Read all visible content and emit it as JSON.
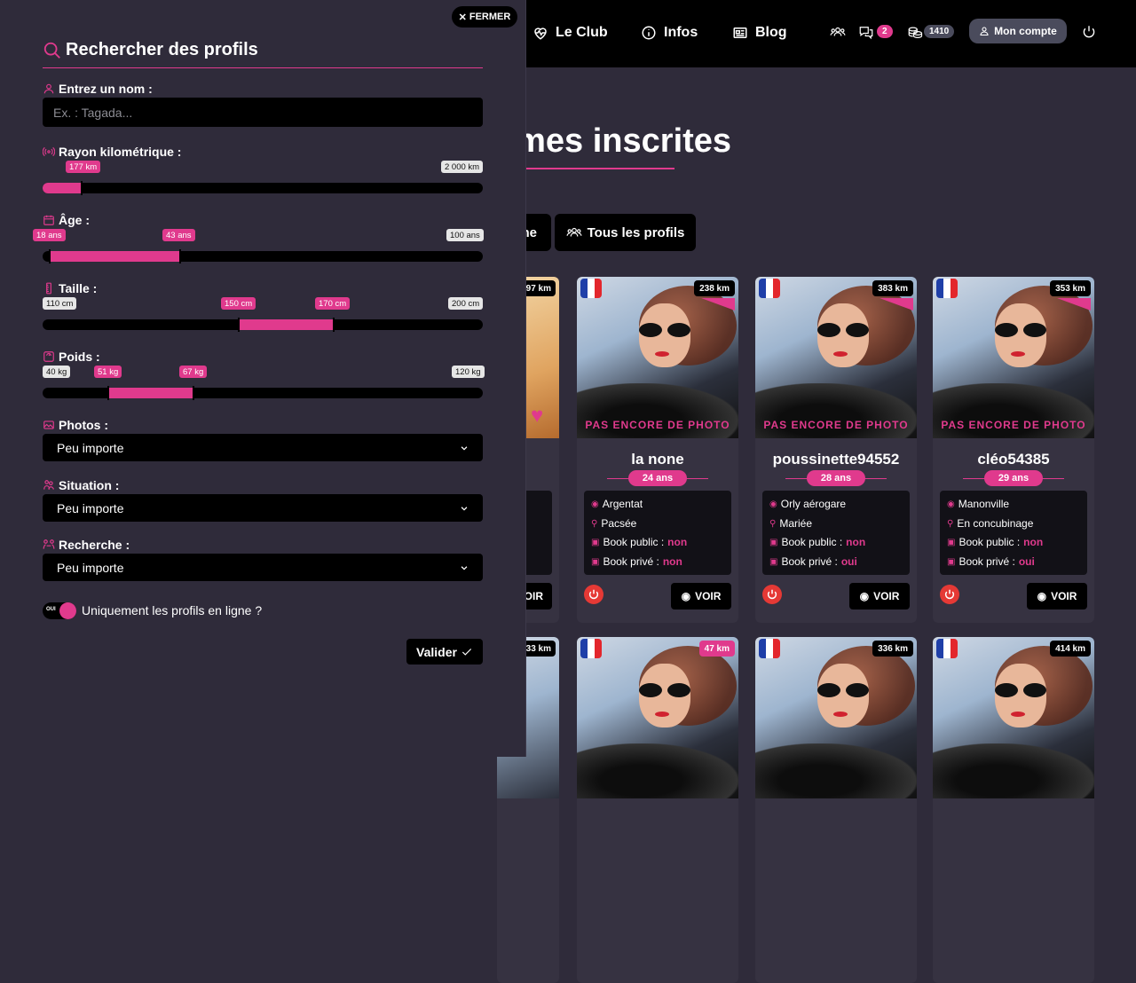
{
  "nav": {
    "links": [
      {
        "label": "Le Club",
        "icon": "heart-pulse-icon"
      },
      {
        "label": "Infos",
        "icon": "info-icon"
      },
      {
        "label": "Blog",
        "icon": "newspaper-icon"
      }
    ],
    "messages_count": "2",
    "credits": "1410",
    "account_label": "Mon compte"
  },
  "page": {
    "title": "ames inscrites",
    "tab_partial": "ne",
    "tab_all": "Tous les profils",
    "partial_km_1": "97 km",
    "partial_km_2": "33 km",
    "partial_voir": "OIR"
  },
  "cards": [
    {
      "km": "238 km",
      "no_photo": "PAS ENCORE DE PHOTO",
      "name": "la none",
      "age": "24 ans",
      "city": "Argentat",
      "status": "Pacsée",
      "book_public_label": "Book public : ",
      "book_public": "non",
      "book_private_label": "Book privé : ",
      "book_private": "non",
      "voir": "VOIR"
    },
    {
      "km": "383 km",
      "no_photo": "PAS ENCORE DE PHOTO",
      "name": "poussinette94552",
      "age": "28 ans",
      "city": "Orly aérogare",
      "status": "Mariée",
      "book_public_label": "Book public : ",
      "book_public": "non",
      "book_private_label": "Book privé : ",
      "book_private": "oui",
      "voir": "VOIR"
    },
    {
      "km": "353 km",
      "no_photo": "PAS ENCORE DE PHOTO",
      "name": "cléo54385",
      "age": "29 ans",
      "city": "Manonville",
      "status": "En concubinage",
      "book_public_label": "Book public : ",
      "book_public": "non",
      "book_private_label": "Book privé : ",
      "book_private": "oui",
      "voir": "VOIR"
    }
  ],
  "cards_row2": [
    "47 km",
    "336 km",
    "414 km"
  ],
  "panel": {
    "close_label": "FERMER",
    "title": "Rechercher des profils",
    "name_label": "Entrez un nom :",
    "name_placeholder": "Ex. : Tagada...",
    "radius_label": "Rayon kilométrique :",
    "radius_value": "177 km",
    "radius_max": "2 000 km",
    "radius_fraction": 0.088,
    "age_label": "Âge :",
    "age_min": "18 ans",
    "age_max": "43 ans",
    "age_limit": "100 ans",
    "height_label": "Taille :",
    "height_limit_min": "110 cm",
    "height_min": "150 cm",
    "height_max": "170 cm",
    "height_limit_max": "200 cm",
    "weight_label": "Poids :",
    "weight_limit_min": "40 kg",
    "weight_min": "51 kg",
    "weight_max": "67 kg",
    "weight_limit_max": "120 kg",
    "photos_label": "Photos :",
    "photos_value": "Peu importe",
    "situation_label": "Situation :",
    "situation_value": "Peu importe",
    "search_label": "Recherche :",
    "search_value": "Peu importe",
    "toggle_text": "OUI",
    "online_label": "Uniquement les profils en ligne ?",
    "submit_label": "Valider"
  },
  "colors": {
    "accent": "#e03a8d",
    "panel": "#2f2b3a",
    "bar": "#000000"
  }
}
